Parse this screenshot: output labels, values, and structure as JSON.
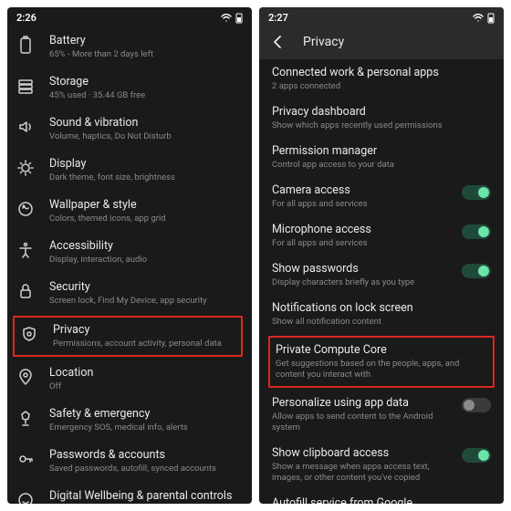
{
  "left": {
    "time": "2:26",
    "items": [
      {
        "icon": "battery",
        "title": "Battery",
        "sub": "65% - More than 2 days left"
      },
      {
        "icon": "storage",
        "title": "Storage",
        "sub": "45% used · 35.44 GB free"
      },
      {
        "icon": "sound",
        "title": "Sound & vibration",
        "sub": "Volume, haptics, Do Not Disturb"
      },
      {
        "icon": "display",
        "title": "Display",
        "sub": "Dark theme, font size, brightness"
      },
      {
        "icon": "wallpaper",
        "title": "Wallpaper & style",
        "sub": "Colors, themed icons, app grid"
      },
      {
        "icon": "accessibility",
        "title": "Accessibility",
        "sub": "Display, interaction, audio"
      },
      {
        "icon": "security",
        "title": "Security",
        "sub": "Screen lock, Find My Device, app security"
      },
      {
        "icon": "privacy",
        "title": "Privacy",
        "sub": "Permissions, account activity, personal data",
        "hl": true
      },
      {
        "icon": "location",
        "title": "Location",
        "sub": "Off"
      },
      {
        "icon": "safety",
        "title": "Safety & emergency",
        "sub": "Emergency SOS, medical info, alerts"
      },
      {
        "icon": "passwords",
        "title": "Passwords & accounts",
        "sub": "Saved passwords, autofill, synced accounts"
      },
      {
        "icon": "wellbeing",
        "title": "Digital Wellbeing & parental controls",
        "sub": ""
      }
    ]
  },
  "right": {
    "time": "2:27",
    "header": "Privacy",
    "items": [
      {
        "title": "Connected work & personal apps",
        "sub": "2 apps connected"
      },
      {
        "title": "Privacy dashboard",
        "sub": "Show which apps recently used permissions"
      },
      {
        "title": "Permission manager",
        "sub": "Control app access to your data"
      },
      {
        "title": "Camera access",
        "sub": "For all apps and services",
        "toggle": "on"
      },
      {
        "title": "Microphone access",
        "sub": "For all apps and services",
        "toggle": "on"
      },
      {
        "title": "Show passwords",
        "sub": "Display characters briefly as you type",
        "toggle": "on"
      },
      {
        "title": "Notifications on lock screen",
        "sub": "Show all notification content"
      },
      {
        "title": "Private Compute Core",
        "sub": "Get suggestions based on the people, apps, and content you interact with",
        "hl": true
      },
      {
        "title": "Personalize using app data",
        "sub": "Allow apps to send content to the Android system",
        "toggle": "off"
      },
      {
        "title": "Show clipboard access",
        "sub": "Show a message when apps access text, images, or other content you've copied",
        "toggle": "on"
      },
      {
        "title": "Autofill service from Google",
        "sub": ""
      }
    ]
  }
}
